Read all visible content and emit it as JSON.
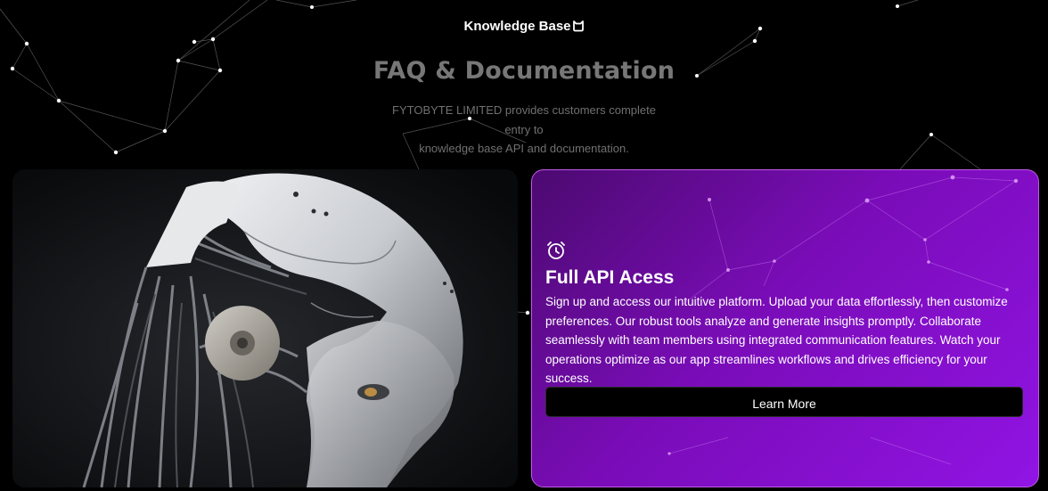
{
  "header": {
    "brand": "Knowledge Base",
    "brand_icon": "cat-outline-icon",
    "title": "FAQ & Documentation",
    "subtitle_lines": [
      "FYTOBYTE LIMITED provides customers complete",
      "entry to",
      "knowledge base API and documentation."
    ]
  },
  "image_card": {
    "subject": "robot-head-image"
  },
  "feature_card": {
    "icon": "alarm-clock-icon",
    "title": "Full API Acess",
    "description": "Sign up and access our intuitive platform. Upload your data effortlessly, then customize preferences. Our robust tools analyze and generate insights promptly. Collaborate seamlessly with team members using integrated communication features. Watch your operations optimize as our app streamlines workflows and drives efficiency for your success.",
    "button_label": "Learn More"
  },
  "colors": {
    "background": "#000000",
    "card_gradient_start": "#4c0a70",
    "card_gradient_end": "#9114e4",
    "card_border": "#c05ae8",
    "title_gray": "#777777",
    "button_bg": "#000000"
  }
}
